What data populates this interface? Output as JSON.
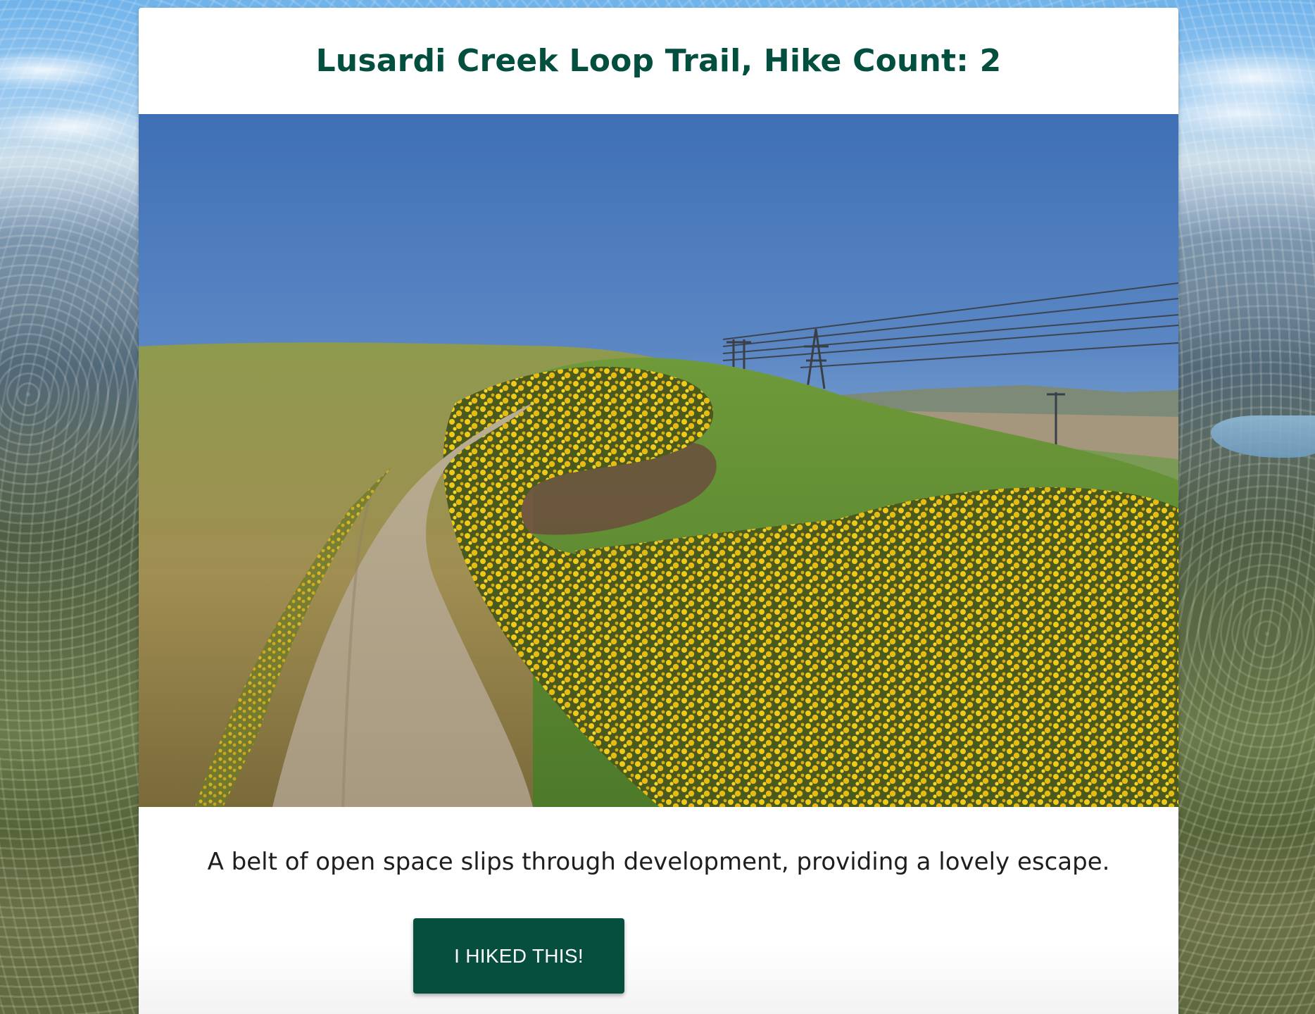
{
  "trail": {
    "title": "Lusardi Creek Loop Trail, Hike Count: 2",
    "description": "A belt of open space slips through development, providing a lovely escape.",
    "hiked_button_label": "I HIKED THIS!"
  },
  "colors": {
    "accent": "#064f3f",
    "title": "#034f3f"
  }
}
